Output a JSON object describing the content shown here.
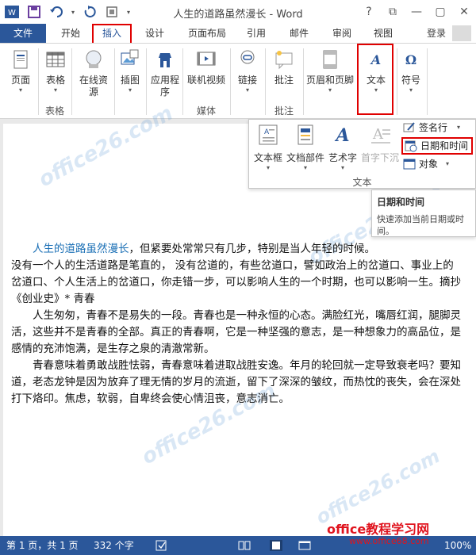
{
  "window": {
    "title": "人生的道路虽然漫长 - Word",
    "controls": [
      "?",
      "⧉",
      "—",
      "▢",
      "✕"
    ]
  },
  "tabs": [
    {
      "label": "文件"
    },
    {
      "label": "开始"
    },
    {
      "label": "插入"
    },
    {
      "label": "设计"
    },
    {
      "label": "页面布局"
    },
    {
      "label": "引用"
    },
    {
      "label": "邮件"
    },
    {
      "label": "审阅"
    },
    {
      "label": "视图"
    }
  ],
  "account": {
    "login_label": "登录"
  },
  "ribbon": {
    "buttons": {
      "page": "页面",
      "table": "表格",
      "online_src_1": "在线资",
      "online_src_2": "源",
      "illustrations": "插图",
      "apps_1": "应用程",
      "apps_2": "序",
      "online_video": "联机视频",
      "links": "链接",
      "comment": "批注",
      "header_footer": "页眉和页脚",
      "text": "文本",
      "symbols": "符号"
    },
    "groups": {
      "table": "表格",
      "media": "媒体",
      "comments": "批注"
    }
  },
  "text_dropdown": {
    "textbox": "文本框",
    "quickparts": "文档部件",
    "wordart": "艺术字",
    "dropcap": "首字下沉",
    "signature_line": "签名行",
    "date_time": "日期和时间",
    "object": "对象",
    "group_label": "文本"
  },
  "tooltip": {
    "title": "日期和时间",
    "desc": "快速添加当前日期或时间。"
  },
  "document": {
    "link_text": "人生的道路虽然漫长",
    "p1_rest": "，但紧要处常常只有几步，特别是当人年轻的时候。",
    "p2": "没有一个人的生活道路是笔直的， 没有岔道的，有些岔道口，譬如政治上的岔道口、事业上的岔道口、个人生活上的岔道口，你走错一步，可以影响人生的一个时期，也可以影响一生。摘抄《创业史》* 青春",
    "p3": "人生匆匆，青春不是易失的一段。青春也是一种永恒的心态。满脸红光，嘴唇红润，腿脚灵活，这些并不是青春的全部。真正的青春啊，它是一种坚强的意志，是一种想象力的高品位，是感情的充沛饱满，是生存之泉的清澈常新。",
    "p4": "青春意味着勇敢战胜怯弱，青春意味着进取战胜安逸。年月的轮回就一定导致衰老吗？要知道，老态龙钟是因为放弃了理无情的岁月的流逝，留下了深深的皱纹，而热忱的丧失，会在深处打下烙印。焦虑，软弱，自卑终会使心情沮丧，意志消亡。"
  },
  "status": {
    "page": "第 1 页，共 1 页",
    "words": "332 个字",
    "zoom": "100%"
  },
  "watermark": {
    "brand": "office教程学习网",
    "url": "www.office68.com",
    "mark": "office26.com"
  },
  "colors": {
    "word_blue": "#2b579a",
    "highlight_red": "#e00000"
  }
}
